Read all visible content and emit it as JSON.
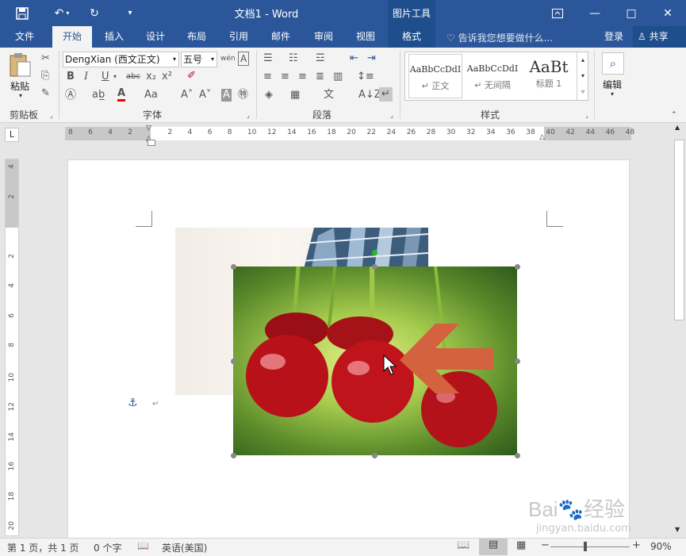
{
  "window": {
    "title": "文档1 - Word",
    "context_group": "图片工具"
  },
  "qat": {
    "save": "save-icon",
    "undo": "undo-icon",
    "redo": "redo-icon",
    "customize": "customize-icon"
  },
  "window_controls": {
    "restore_ribbon": "ribbon-display-icon",
    "minimize": "—",
    "maximize": "□",
    "close": "✕"
  },
  "tabs": [
    "文件",
    "开始",
    "插入",
    "设计",
    "布局",
    "引用",
    "邮件",
    "审阅",
    "视图",
    "格式"
  ],
  "tell_me": "告诉我您想要做什么...",
  "signin": "登录",
  "share": "共享",
  "ribbon": {
    "clipboard": {
      "label": "剪贴板",
      "paste": "粘贴"
    },
    "font": {
      "label": "字体",
      "name": "DengXian (西文正文)",
      "size": "五号",
      "wen": "wén",
      "A": "A"
    },
    "paragraph": {
      "label": "段落"
    },
    "styles": {
      "label": "样式",
      "items": [
        {
          "preview": "AaBbCcDdI",
          "name": "↵ 正文"
        },
        {
          "preview": "AaBbCcDdI",
          "name": "↵ 无间隔"
        },
        {
          "preview": "AaBt",
          "name": "标题 1"
        }
      ]
    },
    "editing": {
      "label": "编辑"
    }
  },
  "ruler": {
    "ticks": [
      "8",
      "6",
      "4",
      "2",
      "",
      "2",
      "4",
      "6",
      "8",
      "10",
      "12",
      "14",
      "16",
      "18",
      "20",
      "22",
      "24",
      "26",
      "28",
      "30",
      "32",
      "34",
      "36",
      "38",
      "40",
      "42",
      "44",
      "46",
      "48"
    ],
    "vticks": [
      "4",
      "2",
      "",
      "2",
      "4",
      "6",
      "8",
      "10",
      "12",
      "14",
      "16",
      "18",
      "20"
    ]
  },
  "document": {
    "anchor": "anchor-icon",
    "para_mark": "↵",
    "arrow_color": "#d4623e"
  },
  "status": {
    "page": "第 1 页，共 1 页",
    "words": "0 个字",
    "lang": "英语(美国)",
    "zoom": "90%",
    "zoom_minus": "−",
    "zoom_plus": "+"
  },
  "watermark": {
    "brand": "Bai",
    "brand2": "经验",
    "url": "jingyan.baidu.com"
  }
}
